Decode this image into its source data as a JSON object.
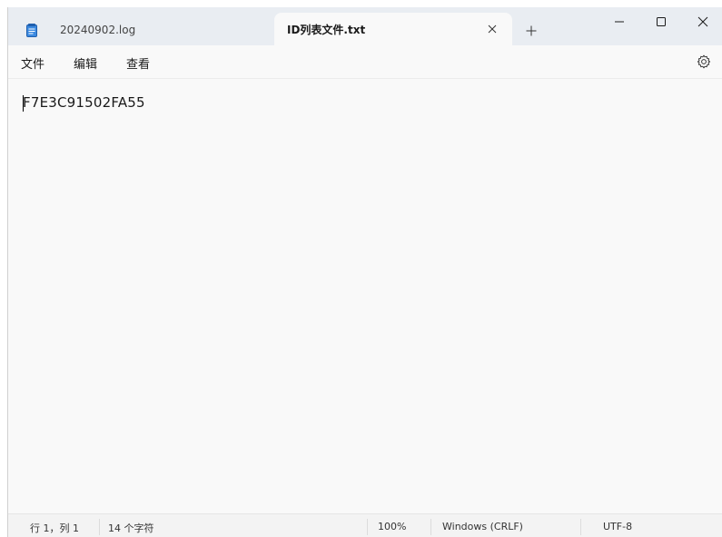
{
  "tabs": [
    {
      "label": "20240902.log",
      "active": false
    },
    {
      "label": "ID列表文件.txt",
      "active": true
    }
  ],
  "window_controls": {
    "minimize_icon": "minimize-icon",
    "maximize_icon": "maximize-icon",
    "close_icon": "close-icon"
  },
  "menu": {
    "file": "文件",
    "edit": "编辑",
    "view": "查看"
  },
  "editor": {
    "content": "F7E3C91502FA55"
  },
  "status": {
    "position": "行 1，列 1",
    "char_count": "14 个字符",
    "zoom": "100%",
    "line_ending": "Windows (CRLF)",
    "encoding": "UTF-8"
  },
  "colors": {
    "titlebar_bg": "#e9edf2",
    "editor_bg": "#f9f9f9",
    "app_icon": "#2b7bd6"
  }
}
